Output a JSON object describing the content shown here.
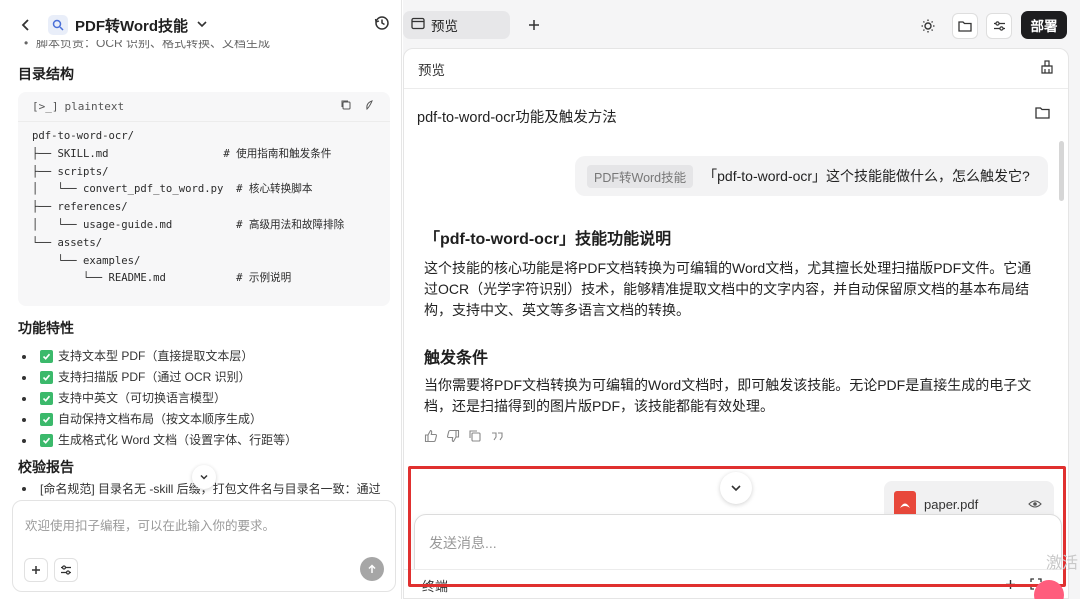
{
  "left_header": {
    "project_name": "PDF转Word技能"
  },
  "left_content": {
    "cut_line": "脚本负责：OCR 识别、格式转换、文档生成",
    "dir_heading": "目录结构",
    "code_lang": "plaintext",
    "code_text": "pdf-to-word-ocr/\n├── SKILL.md                  # 使用指南和触发条件\n├── scripts/\n│   └── convert_pdf_to_word.py  # 核心转换脚本\n├── references/\n│   └── usage-guide.md          # 高级用法和故障排除\n└── assets/\n    └── examples/\n        └── README.md           # 示例说明",
    "features_heading": "功能特性",
    "features": [
      "支持文本型 PDF（直接提取文本层）",
      "支持扫描版 PDF（通过 OCR 识别）",
      "支持中英文（可切换语言模型）",
      "自动保持文档布局（按文本顺序生成）",
      "生成格式化 Word 文档（设置字体、行距等）"
    ],
    "validation_heading": "校验报告",
    "validation_item": "[命名规范] 目录名无 -skill 后缀，打包文件名与目录名一致：通过"
  },
  "left_input": {
    "placeholder": "欢迎使用扣子编程，可以在此输入你的要求。"
  },
  "right_top": {
    "tab_label": "预览",
    "deploy_label": "部署"
  },
  "preview": {
    "header": "预览",
    "conversation_title": "pdf-to-word-ocr功能及触发方法",
    "user_message": {
      "skill_chip": "PDF转Word技能",
      "text": "「pdf-to-word-ocr」这个技能能做什么，怎么触发它?"
    },
    "answer": {
      "heading1": "「pdf-to-word-ocr」技能功能说明",
      "para1": "这个技能的核心功能是将PDF文档转换为可编辑的Word文档，尤其擅长处理扫描版PDF文件。它通过OCR（光学字符识别）技术，能够精准提取文档中的文字内容，并自动保留原文档的基本布局结构，支持中文、英文等多语言文档的转换。",
      "heading2": "触发条件",
      "para2": "当你需要将PDF文档转换为可编辑的Word文档时，即可触发该技能。无论PDF是直接生成的电子文档，还是扫描得到的图片版PDF，该技能都能有效处理。"
    },
    "file_chip": {
      "name": "paper.pdf"
    },
    "chat_input": {
      "placeholder": "发送消息..."
    },
    "terminal_label": "终端"
  },
  "watermark": "激活",
  "colors": {
    "accent_red": "#e0302f",
    "deploy_bg": "#1d1d1f",
    "check_green": "#3bb96b",
    "pdf_red": "#e8483b"
  }
}
